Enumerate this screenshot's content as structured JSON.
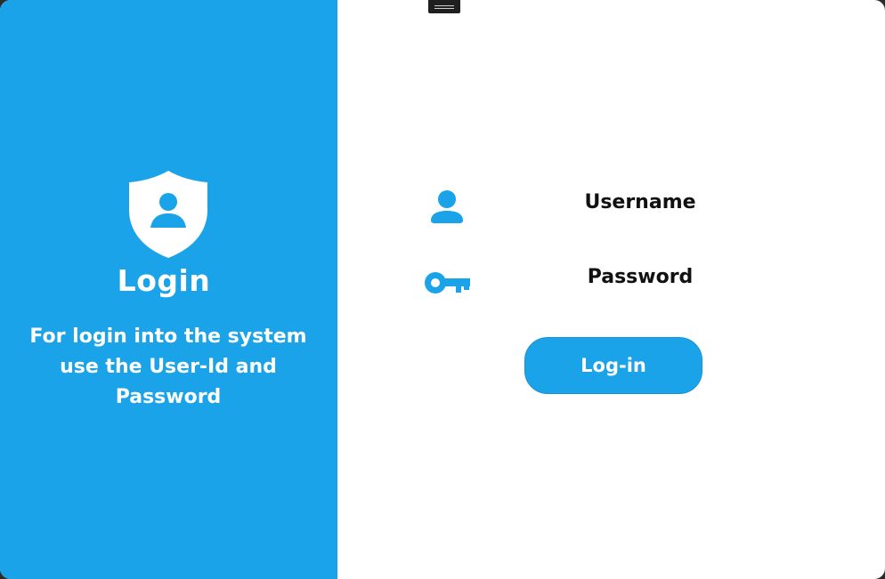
{
  "brand": {
    "accent_color": "#1ba3ea"
  },
  "left_panel": {
    "icon": "shield-user-icon",
    "title": "Login",
    "description_lines": [
      "For login into the system",
      "use the User-Id and",
      "Password"
    ]
  },
  "form": {
    "username": {
      "icon": "user-icon",
      "placeholder": "Username",
      "value": ""
    },
    "password": {
      "icon": "key-icon",
      "placeholder": "Password",
      "value": ""
    },
    "submit_label": "Log-in"
  }
}
